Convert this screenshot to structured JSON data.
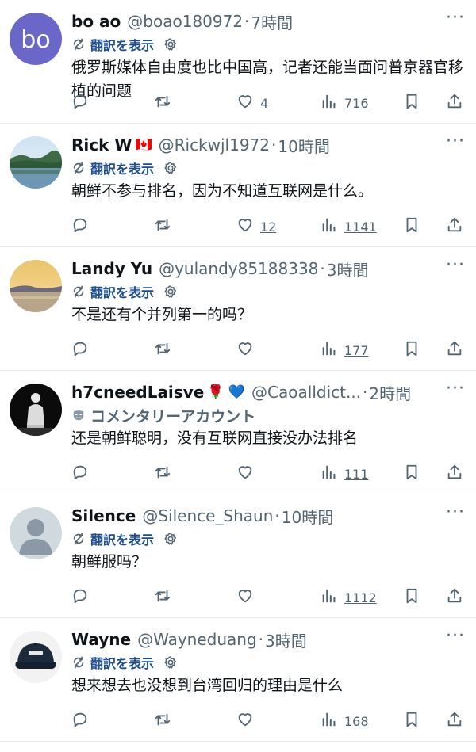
{
  "labels": {
    "translate": "翻訳を表示",
    "commentary": "コメンタリーアカウント"
  },
  "colors": {
    "text": "#0f1419",
    "muted": "#536471",
    "link": "#1d4d8c",
    "divider": "#e7e9ea"
  },
  "tweets": [
    {
      "name": "bo ao",
      "flag": "",
      "handle": "@boao180972",
      "time": "7時間",
      "sub": "translate",
      "text": "俄罗斯媒体自由度也比中国高，记者还能当面问普京器官移植的问题",
      "likes": "4",
      "views": "716",
      "avatar": "bo-initials",
      "avatar_text": "bo"
    },
    {
      "name": "Rick W",
      "flag": "🇨🇦",
      "handle": "@Rickwjl1972",
      "time": "10時間",
      "sub": "translate",
      "text": "朝鲜不参与排名，因为不知道互联网是什么。",
      "likes": "12",
      "views": "1141",
      "avatar": "lake-photo"
    },
    {
      "name": "Landy Yu",
      "flag": "",
      "handle": "@yulandy85188338",
      "time": "3時間",
      "sub": "translate",
      "text": "不是还有个并列第一的吗？",
      "likes": "",
      "views": "177",
      "avatar": "sunset-photo"
    },
    {
      "name": "h7cneedLaisve",
      "flag": "🌹 💙",
      "handle": "@Caoalldict...",
      "time": "2時間",
      "sub": "commentary",
      "text": "还是朝鲜聪明，没有互联网直接没办法排名",
      "likes": "",
      "views": "111",
      "avatar": "dark-figure"
    },
    {
      "name": "Silence",
      "flag": "",
      "handle": "@Silence_Shaun",
      "time": "10時間",
      "sub": "translate",
      "text": "朝鲜服吗？",
      "likes": "",
      "views": "1112",
      "avatar": "default-person"
    },
    {
      "name": "Wayne",
      "flag": "",
      "handle": "@Wayneduang",
      "time": "3時間",
      "sub": "translate",
      "text": "想来想去也没想到台湾回归的理由是什么",
      "likes": "",
      "views": "168",
      "avatar": "cap-photo"
    }
  ]
}
